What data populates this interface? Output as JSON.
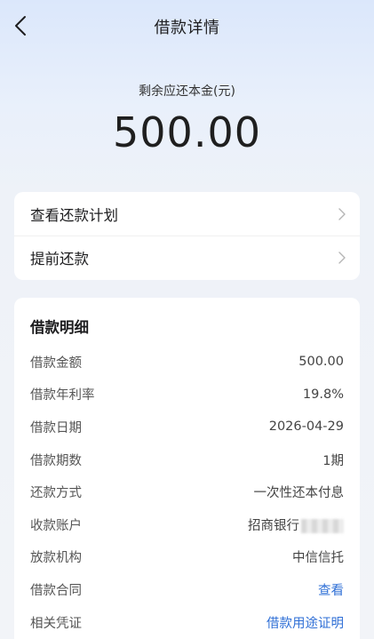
{
  "header": {
    "title": "借款详情"
  },
  "summary": {
    "label": "剩余应还本金(元)",
    "amount": "500.00"
  },
  "actions": [
    {
      "label": "查看还款计划"
    },
    {
      "label": "提前还款"
    }
  ],
  "details": {
    "title": "借款明细",
    "rows": [
      {
        "label": "借款金额",
        "value": "500.00"
      },
      {
        "label": "借款年利率",
        "value": "19.8%"
      },
      {
        "label": "借款日期",
        "value": "2026-04-29"
      },
      {
        "label": "借款期数",
        "value": "1期"
      },
      {
        "label": "还款方式",
        "value": "一次性还本付息"
      },
      {
        "label": "收款账户",
        "value": "招商银行"
      },
      {
        "label": "放款机构",
        "value": "中信信托"
      },
      {
        "label": "借款合同",
        "value": "查看"
      },
      {
        "label": "相关凭证",
        "value": "借款用途证明"
      }
    ]
  },
  "colors": {
    "link": "#2f6fd6",
    "background_top": "#dbe7fb"
  }
}
